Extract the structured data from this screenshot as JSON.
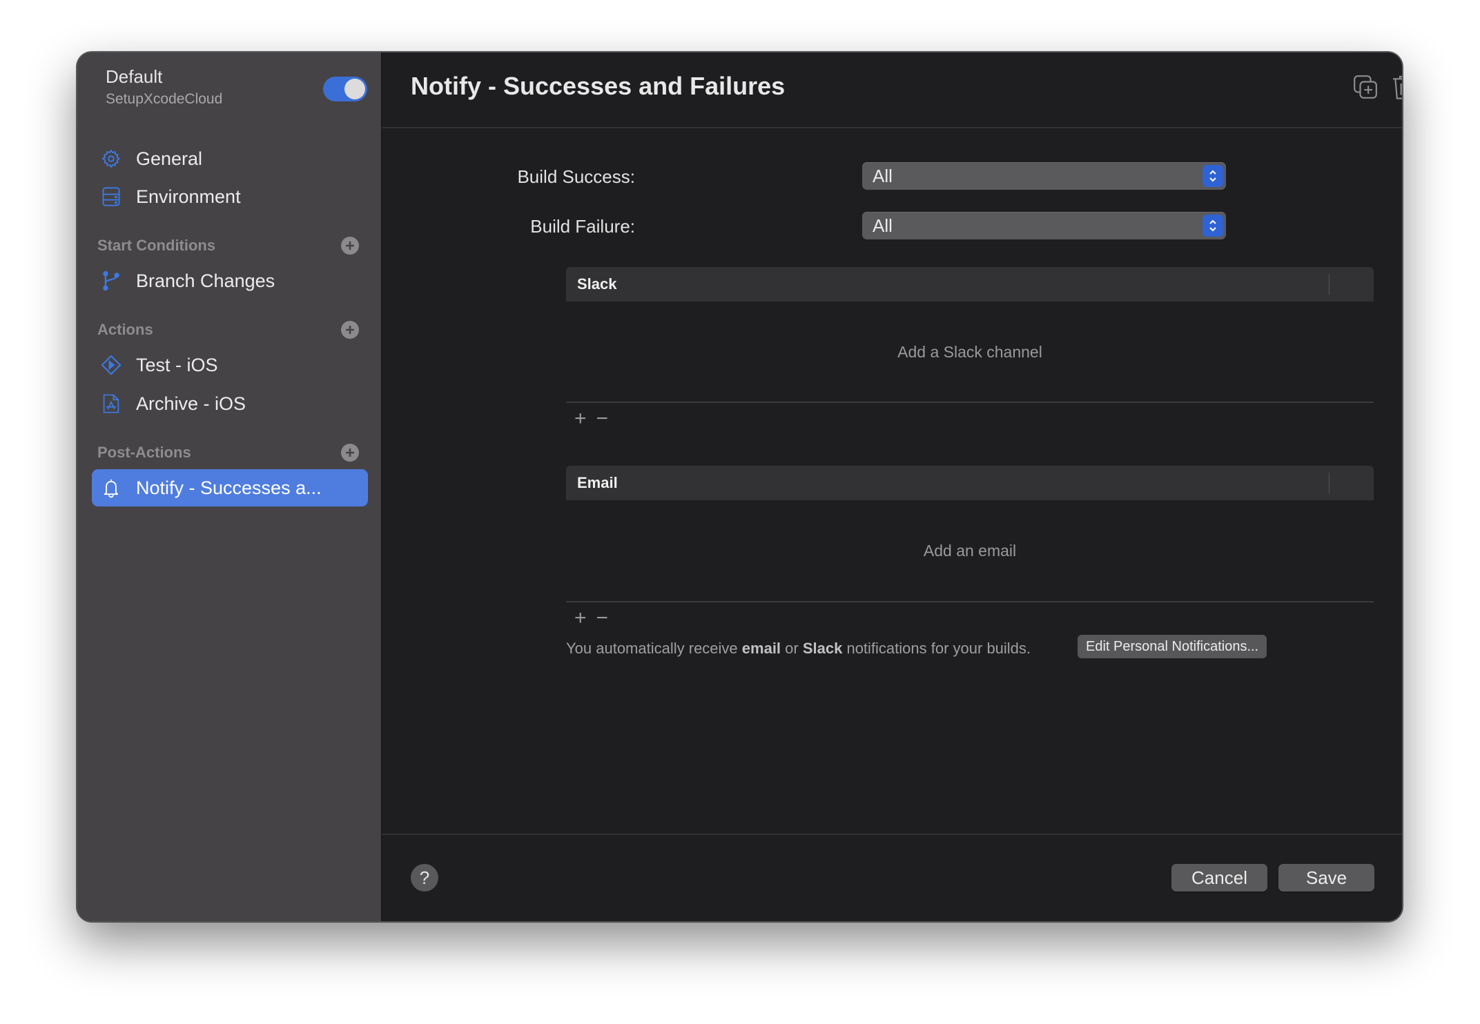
{
  "sidebar": {
    "workflow_name": "Default",
    "product_name": "SetupXcodeCloud",
    "workflow_enabled": true,
    "items": [
      {
        "label": "General",
        "icon": "gear-icon"
      },
      {
        "label": "Environment",
        "icon": "server-icon"
      }
    ],
    "sections": [
      {
        "title": "Start Conditions",
        "items": [
          {
            "label": "Branch Changes",
            "icon": "branch-icon"
          }
        ]
      },
      {
        "title": "Actions",
        "items": [
          {
            "label": "Test - iOS",
            "icon": "test-play-icon"
          },
          {
            "label": "Archive - iOS",
            "icon": "archive-appstore-icon"
          }
        ]
      },
      {
        "title": "Post-Actions",
        "items": [
          {
            "label": "Notify - Successes a...",
            "icon": "bell-icon",
            "selected": true
          }
        ]
      }
    ]
  },
  "header": {
    "title": "Notify - Successes and Failures",
    "duplicate_icon": "duplicate-icon",
    "delete_icon": "trash-icon"
  },
  "form": {
    "build_success_label": "Build Success:",
    "build_success_value": "All",
    "build_failure_label": "Build Failure:",
    "build_failure_value": "All"
  },
  "slack": {
    "header": "Slack",
    "empty_text": "Add a Slack channel",
    "add": "+",
    "remove": "−"
  },
  "email": {
    "header": "Email",
    "empty_text": "Add an email",
    "add": "+",
    "remove": "−"
  },
  "info": {
    "prefix": "You automatically receive ",
    "bold1": "email",
    "mid": " or ",
    "bold2": "Slack",
    "suffix": " notifications for your builds.",
    "button": "Edit Personal Notifications..."
  },
  "footer": {
    "help": "?",
    "cancel": "Cancel",
    "save": "Save"
  },
  "colors": {
    "accent": "#4f7ddf",
    "toggle_on": "#3b6fd8",
    "icon_blue": "#3d7ae5"
  }
}
